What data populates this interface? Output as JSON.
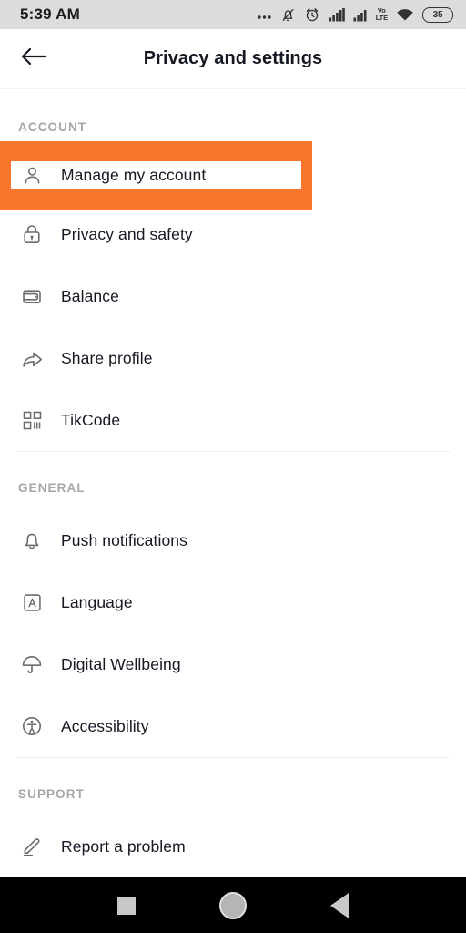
{
  "status_bar": {
    "time": "5:39 AM",
    "battery_level": "35",
    "network_label_top": "Vo",
    "network_label_bottom": "LTE",
    "icons": [
      "more-dots-icon",
      "bell-muted-icon",
      "alarm-clock-icon",
      "signal-bars-icon",
      "signal-bars-icon",
      "volte-icon",
      "wifi-icon",
      "battery-icon"
    ]
  },
  "header": {
    "title": "Privacy and settings",
    "back_icon": "arrow-left-icon"
  },
  "sections": [
    {
      "label": "ACCOUNT",
      "items": [
        {
          "label": "Manage my account",
          "icon": "person-icon",
          "highlighted": true
        },
        {
          "label": "Privacy and safety",
          "icon": "lock-icon",
          "highlighted": false
        },
        {
          "label": "Balance",
          "icon": "wallet-icon",
          "highlighted": false
        },
        {
          "label": "Share profile",
          "icon": "share-arrow-icon",
          "highlighted": false
        },
        {
          "label": "TikCode",
          "icon": "qr-code-icon",
          "highlighted": false
        }
      ]
    },
    {
      "label": "GENERAL",
      "items": [
        {
          "label": "Push notifications",
          "icon": "bell-icon",
          "highlighted": false
        },
        {
          "label": "Language",
          "icon": "letter-a-box-icon",
          "highlighted": false
        },
        {
          "label": "Digital Wellbeing",
          "icon": "umbrella-icon",
          "highlighted": false
        },
        {
          "label": "Accessibility",
          "icon": "accessibility-icon",
          "highlighted": false
        }
      ]
    },
    {
      "label": "SUPPORT",
      "items": [
        {
          "label": "Report a problem",
          "icon": "pencil-icon",
          "highlighted": false
        }
      ]
    }
  ],
  "nav_bar": {
    "recents": "square-icon",
    "home": "circle-icon",
    "back": "triangle-back-icon"
  },
  "colors": {
    "highlight_orange": "#f9762b",
    "status_bar_bg": "#dcdcdc",
    "text_primary": "#161823",
    "text_muted": "#a6a6ab"
  }
}
